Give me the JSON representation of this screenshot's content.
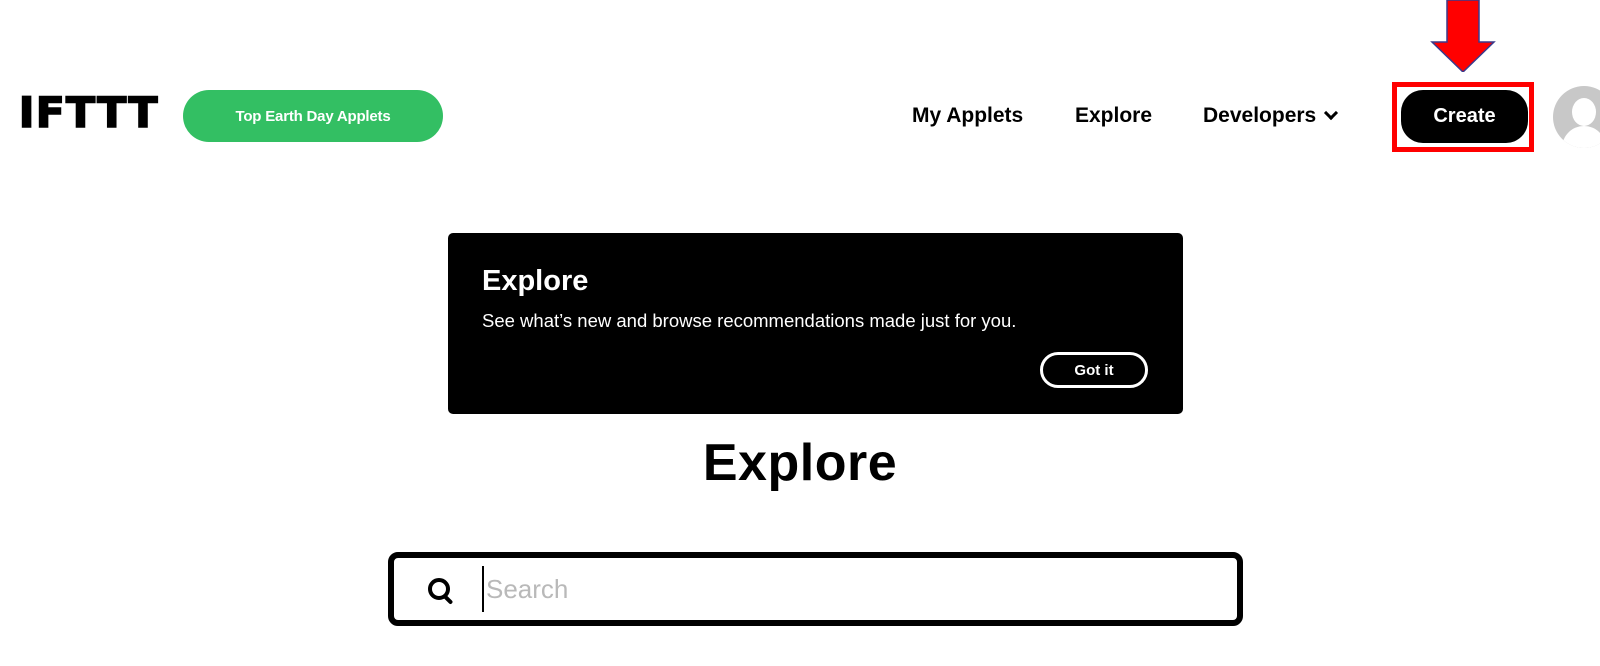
{
  "header": {
    "logo": "IFTTT",
    "promo_button": "Top Earth Day Applets",
    "nav": [
      {
        "label": "My Applets"
      },
      {
        "label": "Explore"
      },
      {
        "label": "Developers",
        "icon": "chevron-down-icon"
      }
    ],
    "create_button": "Create",
    "avatar_icon": "user-avatar-icon"
  },
  "annotation": {
    "arrow_color": "#ff0000",
    "highlight_color": "#ff0000",
    "target": "Create"
  },
  "banner": {
    "title": "Explore",
    "text": "See what’s new and browse recommendations made just for you.",
    "button": "Got it"
  },
  "main": {
    "title": "Explore",
    "search": {
      "placeholder": "Search",
      "value": "",
      "icon": "search-icon"
    }
  },
  "colors": {
    "brand_green": "#33bf63",
    "primary": "#000000",
    "background": "#ffffff"
  }
}
